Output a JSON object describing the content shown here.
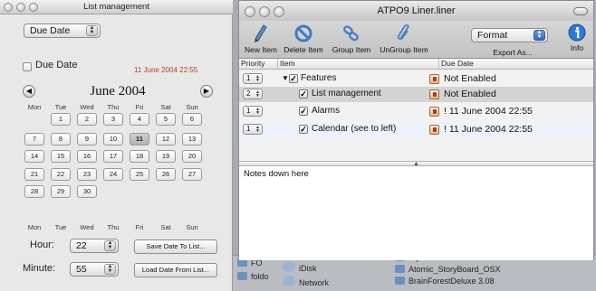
{
  "left_window": {
    "title": "List management",
    "sort_popup": "Due Date",
    "due_date_checkbox_label": "Due Date",
    "due_date_value": "11 June 2004 22:55",
    "month_label": "June 2004",
    "weekdays": [
      "Mon",
      "Tue",
      "Wed",
      "Thu",
      "Fri",
      "Sat",
      "Sun"
    ],
    "weeks": [
      [
        "",
        "1",
        "2",
        "3",
        "4",
        "5",
        "6"
      ],
      [
        "7",
        "8",
        "9",
        "10",
        "11",
        "12",
        "13"
      ],
      [
        "14",
        "15",
        "16",
        "17",
        "18",
        "19",
        "20"
      ],
      [
        "21",
        "22",
        "23",
        "24",
        "25",
        "26",
        "27"
      ],
      [
        "28",
        "29",
        "30",
        "",
        "",
        "",
        ""
      ]
    ],
    "selected_day": "11",
    "hour_label": "Hour:",
    "hour_value": "22",
    "minute_label": "Minute:",
    "minute_value": "55",
    "save_button": "Save Date To List...",
    "load_button": "Load Date From List...",
    "prev_glyph": "◀",
    "next_glyph": "▶"
  },
  "right_window": {
    "title": "ATPO9 Liner.liner",
    "toolbar": {
      "new_item": "New Item",
      "delete_item": "Delete Item",
      "group_item": "Group Item",
      "ungroup_item": "UnGroup Item",
      "export_as": "Export As...",
      "info": "Info",
      "format_popup": "Format"
    },
    "columns": {
      "priority": "Priority",
      "item": "Item",
      "due_date": "Due Date"
    },
    "rows": [
      {
        "priority": "1",
        "item": "Features",
        "due": "Not Enabled"
      },
      {
        "priority": "2",
        "item": "List management",
        "due": "Not Enabled"
      },
      {
        "priority": "1",
        "item": "Alarms",
        "due": "! 11 June 2004 22:55"
      },
      {
        "priority": "1",
        "item": "Calendar (see to left)",
        "due": "! 11 June 2004 22:55"
      }
    ],
    "notes_text": "Notes down here"
  },
  "desktop": {
    "items": [
      "iDisk",
      "Network",
      "Atpo9 2.5.3",
      "Atomic_StoryBoard_OSX",
      "BrainForestDeluxe 3.08",
      "FO",
      "foldo"
    ]
  },
  "colors": {
    "selected_row": "#d3d3d3",
    "alt_row": "#edf3fe",
    "info_blue": "#2f79d9"
  }
}
